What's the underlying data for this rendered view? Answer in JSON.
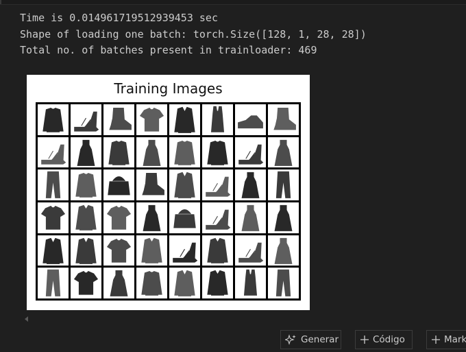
{
  "output": {
    "lines": [
      "Time is 0.014961719512939453 sec",
      "Shape of loading one batch: torch.Size([128, 1, 28, 28])",
      "Total no. of batches present in trainloader: 469"
    ]
  },
  "figure": {
    "title": "Training Images",
    "rows": 6,
    "cols": 8,
    "items": [
      [
        "pullover",
        "sandal",
        "ankle-boot",
        "tshirt",
        "coat",
        "top",
        "sneaker",
        "ankle-boot"
      ],
      [
        "sandal",
        "dress",
        "pullover",
        "dress",
        "pullover",
        "pullover",
        "sandal",
        "dress"
      ],
      [
        "trouser",
        "pullover",
        "bag",
        "ankle-boot",
        "coat",
        "sandal",
        "dress",
        "trouser"
      ],
      [
        "tshirt",
        "shirt",
        "tshirt",
        "dress",
        "bag",
        "sandal",
        "dress",
        "dress"
      ],
      [
        "coat",
        "coat",
        "tshirt",
        "shirt",
        "sandal",
        "shirt",
        "sandal",
        "dress"
      ],
      [
        "trouser",
        "tshirt",
        "dress",
        "pullover",
        "coat",
        "shirt",
        "top",
        "trouser"
      ]
    ]
  },
  "toolbar": {
    "generate_label": "Generar",
    "code_label": "Código",
    "markdown_label": "Markdown"
  },
  "icons": {
    "generate": "sparkle-icon",
    "add": "plus-icon",
    "scroll": "scroll-left-icon"
  }
}
